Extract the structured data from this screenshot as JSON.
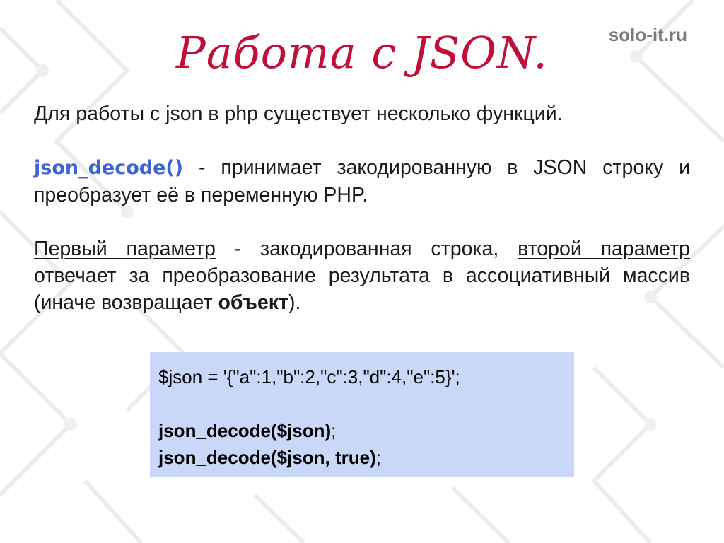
{
  "site": "solo-it.ru",
  "title": "Работа с JSON.",
  "para1": "Для работы с json в php существует несколько функций.",
  "para2": {
    "fn": "json_decode()",
    "text": " - принимает закодированную в JSON строку и преобразует её в переменную PHP."
  },
  "para3": {
    "u1": "Первый параметр",
    "t1": " - закодированная строка, ",
    "u2": "второй параметр",
    "t2": " отвечает за преобразование результата в ассоциативный массив (иначе возвращает ",
    "bold": "объект",
    "t3": ")."
  },
  "code": {
    "line1": "$json = '{\"a\":1,\"b\":2,\"c\":3,\"d\":4,\"e\":5}';",
    "line2_bold": "json_decode($json)",
    "line2_end": ";",
    "line3_bold": "json_decode($json, true)",
    "line3_end": ";"
  }
}
